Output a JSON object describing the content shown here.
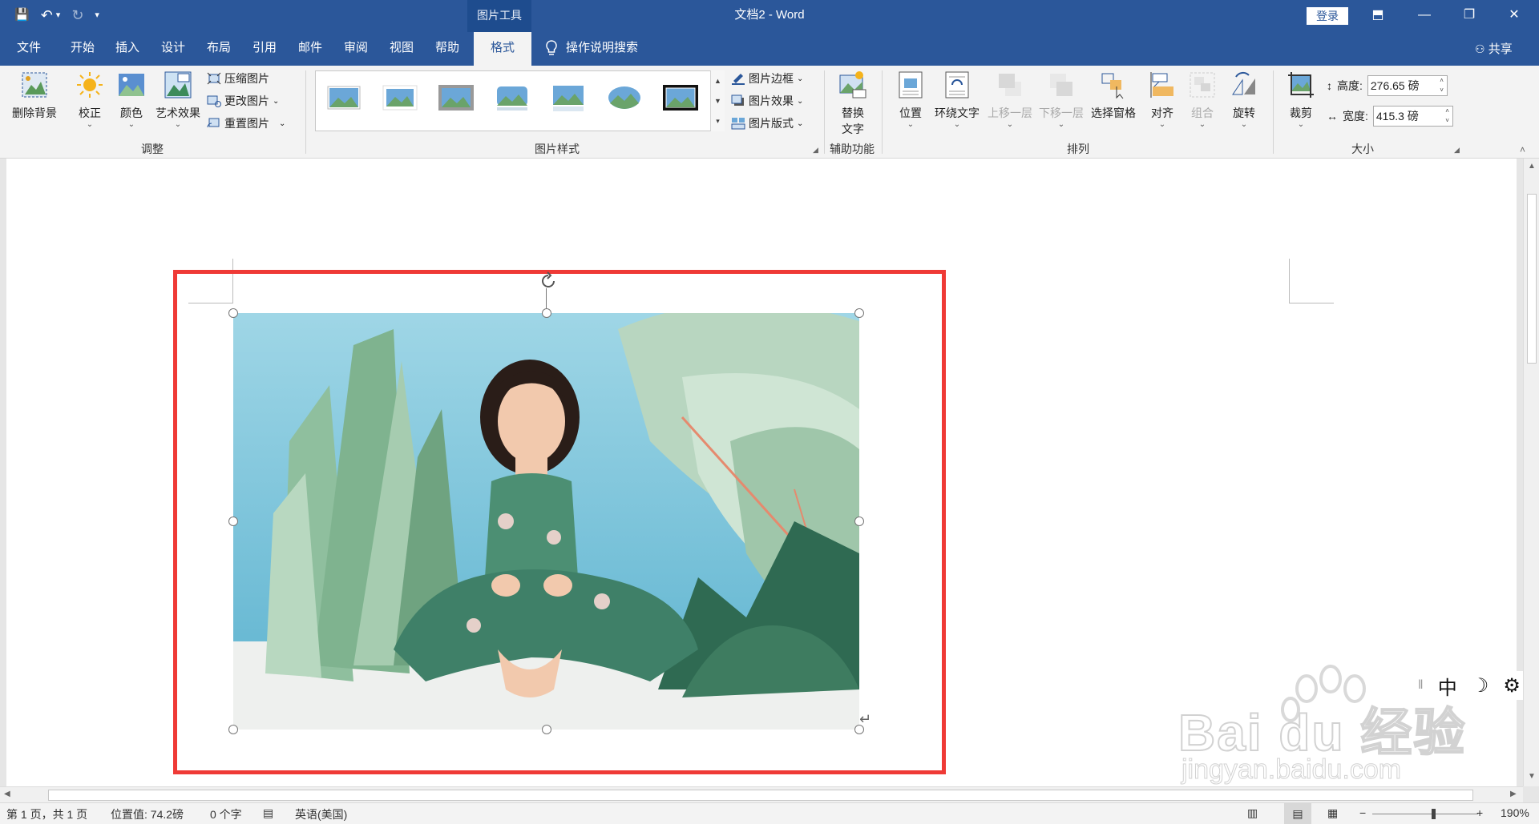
{
  "window": {
    "title": "文档2  -  Word",
    "context_tab_group": "图片工具",
    "login_label": "登录",
    "controls": {
      "ribbon_display": "⬒",
      "minimize": "—",
      "restore": "❐",
      "close": "✕"
    }
  },
  "qat": {
    "save": "💾",
    "undo": "↶",
    "undo_more": "▾",
    "redo": "↻",
    "customize": "▾"
  },
  "tabs": [
    {
      "label": "文件"
    },
    {
      "label": "开始"
    },
    {
      "label": "插入"
    },
    {
      "label": "设计"
    },
    {
      "label": "布局"
    },
    {
      "label": "引用"
    },
    {
      "label": "邮件"
    },
    {
      "label": "审阅"
    },
    {
      "label": "视图"
    },
    {
      "label": "帮助"
    },
    {
      "label": "格式"
    }
  ],
  "tell_me": {
    "icon": "lightbulb-icon",
    "label": "操作说明搜索"
  },
  "share": {
    "label": "共享"
  },
  "ribbon": {
    "adjust": {
      "label": "调整",
      "remove_bg": "删除背景",
      "corrections": "校正",
      "color": "颜色",
      "artistic": "艺术效果",
      "compress": "压缩图片",
      "change": "更改图片",
      "reset": "重置图片"
    },
    "styles": {
      "label": "图片样式",
      "border": "图片边框",
      "effects": "图片效果",
      "layout": "图片版式"
    },
    "accessibility": {
      "label": "辅助功能",
      "alt_text_1": "替换",
      "alt_text_2": "文字"
    },
    "arrange": {
      "label": "排列",
      "position": "位置",
      "wrap": "环绕文字",
      "forward": "上移一层",
      "backward": "下移一层",
      "pane": "选择窗格",
      "align": "对齐",
      "group": "组合",
      "rotate": "旋转"
    },
    "size": {
      "label": "大小",
      "crop": "裁剪",
      "height_label": "高度:",
      "height_value": "276.65 磅",
      "width_label": "宽度:",
      "width_value": "415.3 磅"
    }
  },
  "ime": {
    "mode": "中",
    "moon": "☽",
    "gear": "⚙"
  },
  "watermark": {
    "brand": "Bai du 经验",
    "url": "jingyan.baidu.com"
  },
  "status": {
    "page": "第 1 页，共 1 页",
    "position": "位置值: 74.2磅",
    "words": "0 个字",
    "language": "英语(美国)",
    "zoom": "190%",
    "zoom_minus": "−",
    "zoom_plus": "+"
  },
  "colors": {
    "accent": "#2b579a",
    "selection_frame": "#ef3a36"
  }
}
